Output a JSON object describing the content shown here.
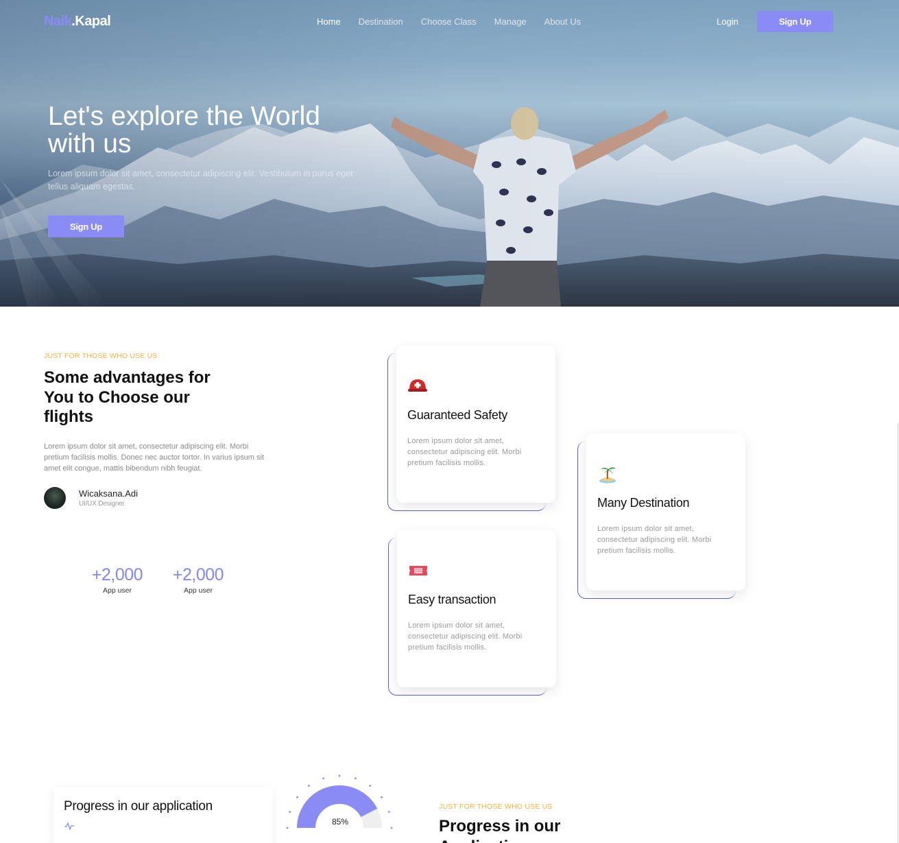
{
  "brand": {
    "part1": "Naik",
    "part2": ".Kapal"
  },
  "nav": {
    "links": [
      "Home",
      "Destination",
      "Choose Class",
      "Manage",
      "About Us"
    ],
    "login": "Login",
    "signup": "Sign Up"
  },
  "hero": {
    "title": "Let's explore the World with us",
    "subtitle": "Lorem ipsum dolor sit amet, consectetur adipiscing elit. Vestibulum in purus eget tellus aliquam egestas.",
    "cta": "Sign Up"
  },
  "advantages": {
    "eyebrow": "JUST FOR THOSE WHO USE US",
    "title": "Some advantages for You to Choose our flights",
    "text": "Lorem ipsum dolor sit amet, consectetur adipiscing elit. Morbi pretium facilisis mollis. Donec nec auctor tortor. In varius ipsum sit amet elit congue, mattis bibendum nibh feugiat.",
    "author_name": "Wicaksana.Adi",
    "author_role": "UI/UX Designer",
    "stats": [
      {
        "value": "+2,000",
        "label": "App user"
      },
      {
        "value": "+2,000",
        "label": "App user"
      }
    ]
  },
  "cards": [
    {
      "icon": "helmet-icon",
      "title": "Guaranteed Safety",
      "text": "Lorem ipsum dolor sit amet, consectetur adipiscing elit. Morbi pretium facilisis mollis."
    },
    {
      "icon": "island-icon",
      "title": "Many Destination",
      "text": "Lorem ipsum dolor sit amet, consectetur adipiscing elit. Morbi pretium facilisis mollis."
    },
    {
      "icon": "ticket-icon",
      "title": "Easy transaction",
      "text": "Lorem ipsum dolor sit amet, consectetur adipiscing elit. Morbi pretium facilisis mollis."
    }
  ],
  "progress": {
    "card_title": "Progress in our application",
    "gauge_value": "85%",
    "gauge_fraction": 0.85,
    "eyebrow": "JUST FOR THOSE WHO USE US",
    "title": "Progress in our Application"
  },
  "colors": {
    "accent": "#8b8bf6",
    "eyebrow": "#f2b33d",
    "outline": "#5b5be6"
  }
}
